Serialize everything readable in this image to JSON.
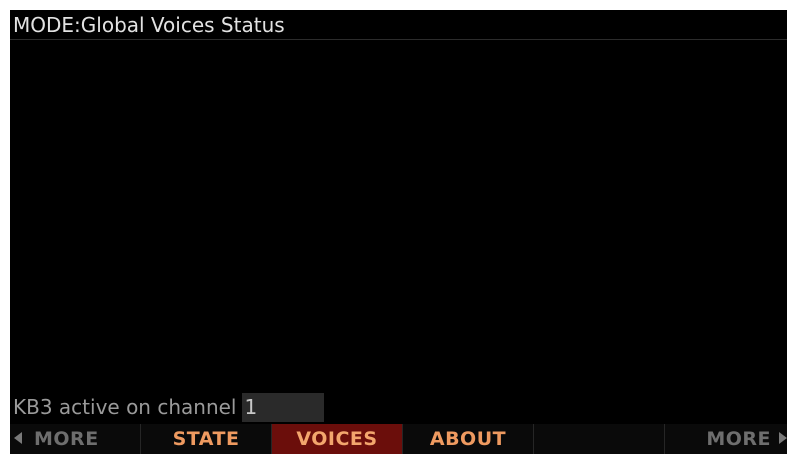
{
  "header": {
    "title": "MODE:Global Voices Status"
  },
  "status": {
    "text": "KB3 active on channel",
    "channel_value": "1"
  },
  "softkeys": {
    "more_left": "MORE",
    "state": "STATE",
    "voices": "VOICES",
    "about": "ABOUT",
    "empty": "",
    "more_right": "MORE"
  },
  "colors": {
    "screen_background": "#000000",
    "softkey_label": "#ee9a60",
    "softkey_active_background": "#6b0e0b",
    "more_label": "#6e6e6e"
  },
  "icons": {
    "left": "arrow-left-icon",
    "right": "arrow-right-icon"
  }
}
